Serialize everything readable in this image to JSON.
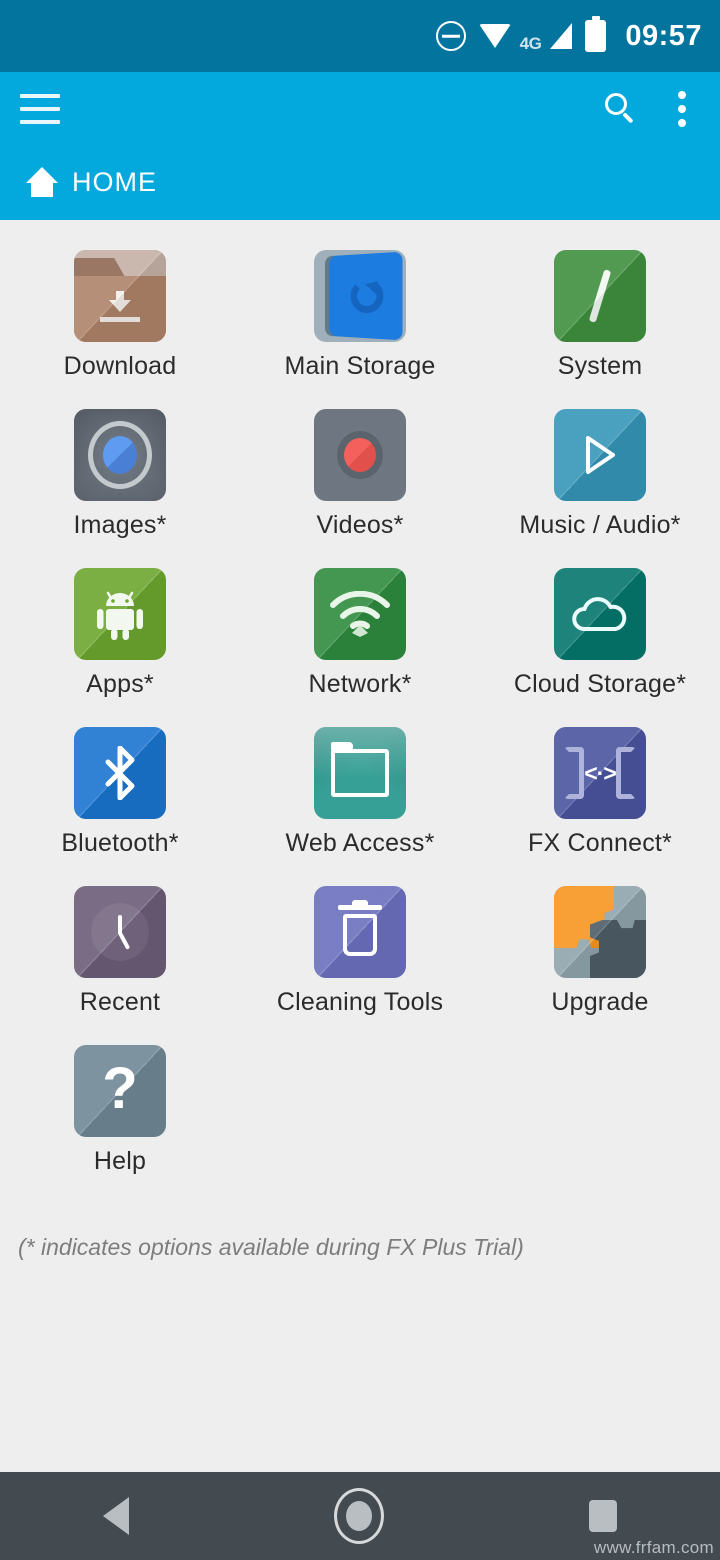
{
  "status_bar": {
    "dnd_icon": "do-not-disturb-icon",
    "wifi_icon": "wifi-icon",
    "network_type": "4G",
    "signal_icon": "cellular-signal-icon",
    "battery_icon": "battery-icon",
    "time": "09:57",
    "background_color": "#03749e"
  },
  "toolbar": {
    "menu_icon": "hamburger-menu-icon",
    "search_icon": "search-icon",
    "overflow_icon": "overflow-menu-icon",
    "breadcrumb_label": "HOME",
    "home_icon": "home-icon",
    "background_color": "#03a9dd"
  },
  "grid": {
    "items": [
      {
        "label": "Download",
        "icon": "folder-download-icon",
        "color": "#ad8268"
      },
      {
        "label": "Main Storage",
        "icon": "device-storage-icon",
        "color": "#1c7ce0"
      },
      {
        "label": "System",
        "icon": "root-slash-icon",
        "color": "#3f8f3f"
      },
      {
        "label": "Images*",
        "icon": "camera-lens-icon",
        "color": "#6e7681"
      },
      {
        "label": "Videos*",
        "icon": "record-dot-icon",
        "color": "#6e7681"
      },
      {
        "label": "Music / Audio*",
        "icon": "play-triangle-icon",
        "color": "#3695b8"
      },
      {
        "label": "Apps*",
        "icon": "android-robot-icon",
        "color": "#6ca62e"
      },
      {
        "label": "Network*",
        "icon": "wifi-signal-icon",
        "color": "#2e8b3d"
      },
      {
        "label": "Cloud Storage*",
        "icon": "cloud-icon",
        "color": "#04756b"
      },
      {
        "label": "Bluetooth*",
        "icon": "bluetooth-icon",
        "color": "#1a74cf"
      },
      {
        "label": "Web Access*",
        "icon": "folder-outline-icon",
        "color": "#37a096"
      },
      {
        "label": "FX Connect*",
        "icon": "devices-code-icon",
        "color": "#4a549e"
      },
      {
        "label": "Recent",
        "icon": "clock-icon",
        "color": "#6b5c77"
      },
      {
        "label": "Cleaning Tools",
        "icon": "trash-can-icon",
        "color": "#6a70be"
      },
      {
        "label": "Upgrade",
        "icon": "puzzle-piece-icon",
        "color": "#f7941e"
      },
      {
        "label": "Help",
        "icon": "question-mark-icon",
        "color": "#6f8795"
      }
    ]
  },
  "footer": {
    "note": "(* indicates options available during FX Plus Trial)"
  },
  "navbar": {
    "back_icon": "back-triangle-icon",
    "home_icon": "home-circle-icon",
    "recents_icon": "recents-square-icon",
    "watermark": "www.frfam.com"
  }
}
